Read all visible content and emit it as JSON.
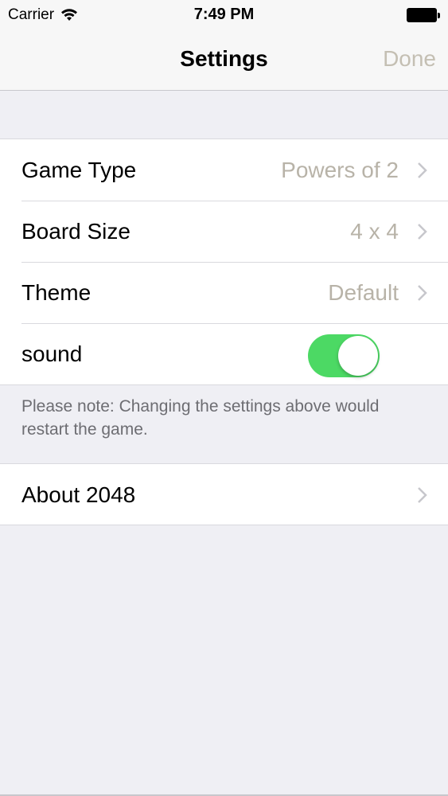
{
  "status_bar": {
    "carrier": "Carrier",
    "time": "7:49 PM",
    "wifi_icon": "wifi-icon",
    "battery_icon": "battery-icon"
  },
  "nav": {
    "title": "Settings",
    "done_label": "Done"
  },
  "settings": {
    "rows": [
      {
        "label": "Game Type",
        "value": "Powers of 2"
      },
      {
        "label": "Board Size",
        "value": "4 x 4"
      },
      {
        "label": "Theme",
        "value": "Default"
      }
    ],
    "sound": {
      "label": "sound",
      "enabled": true
    }
  },
  "note": "Please note: Changing the settings above would restart the game.",
  "about": {
    "label": "About 2048"
  },
  "colors": {
    "background": "#efeff4",
    "toggle_on": "#4cd964",
    "done_disabled": "#c4bfb3",
    "detail_text": "#b8b3a8",
    "chevron": "#c7c7cc"
  }
}
